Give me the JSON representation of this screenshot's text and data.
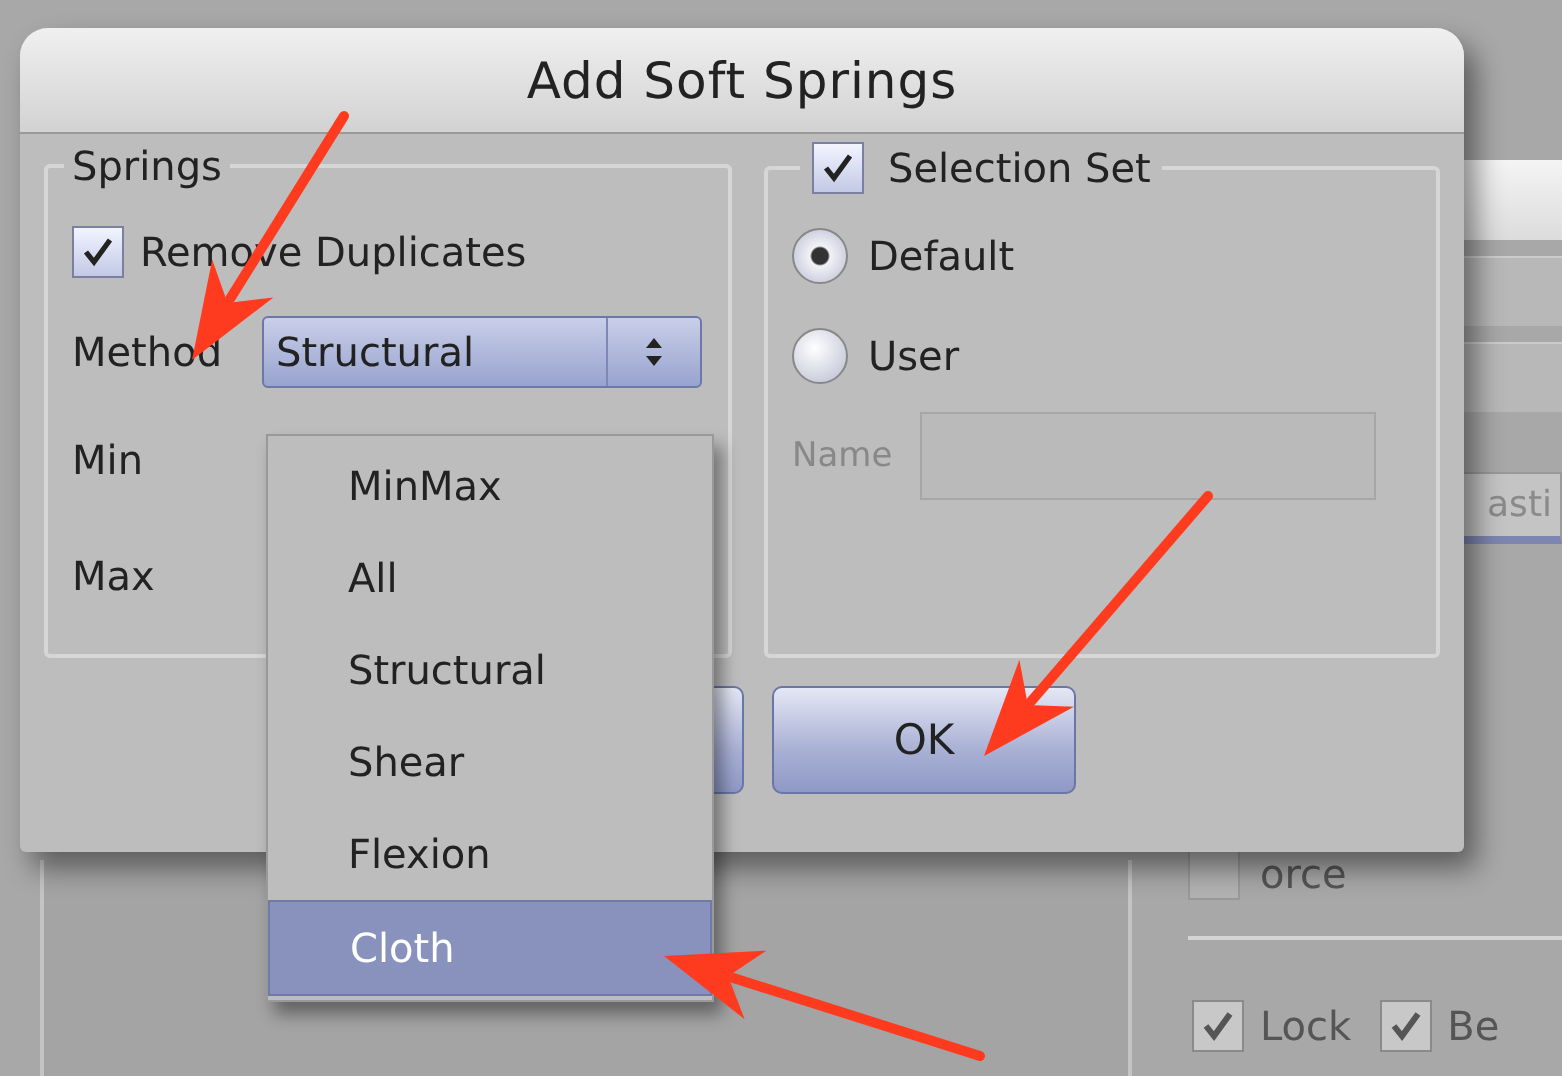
{
  "dialog": {
    "title": "Add Soft Springs"
  },
  "springs": {
    "title": "Springs",
    "remove_duplicates": {
      "label": "Remove Duplicates",
      "checked": true
    },
    "method": {
      "label": "Method",
      "value": "Structural"
    },
    "min_label": "Min",
    "max_label": "Max"
  },
  "selection_set": {
    "label": "Selection Set",
    "checked": true,
    "options": [
      {
        "label": "Default",
        "selected": true
      },
      {
        "label": "User",
        "selected": false
      }
    ],
    "name": {
      "label": "Name",
      "disabled": true
    }
  },
  "buttons": [
    {
      "label": "OK"
    }
  ],
  "dropdown": {
    "items": [
      {
        "label": "MinMax",
        "selected": false
      },
      {
        "label": "All",
        "selected": false
      },
      {
        "label": "Structural",
        "selected": false
      },
      {
        "label": "Shear",
        "selected": false
      },
      {
        "label": "Flexion",
        "selected": false
      },
      {
        "label": "Cloth",
        "selected": true
      }
    ]
  },
  "background": {
    "tab_label": "asti",
    "force": {
      "label": "orce",
      "checked": false
    },
    "checkboxes": [
      {
        "label": "Lock",
        "checked": true
      },
      {
        "label": "Be",
        "checked": true
      }
    ]
  }
}
